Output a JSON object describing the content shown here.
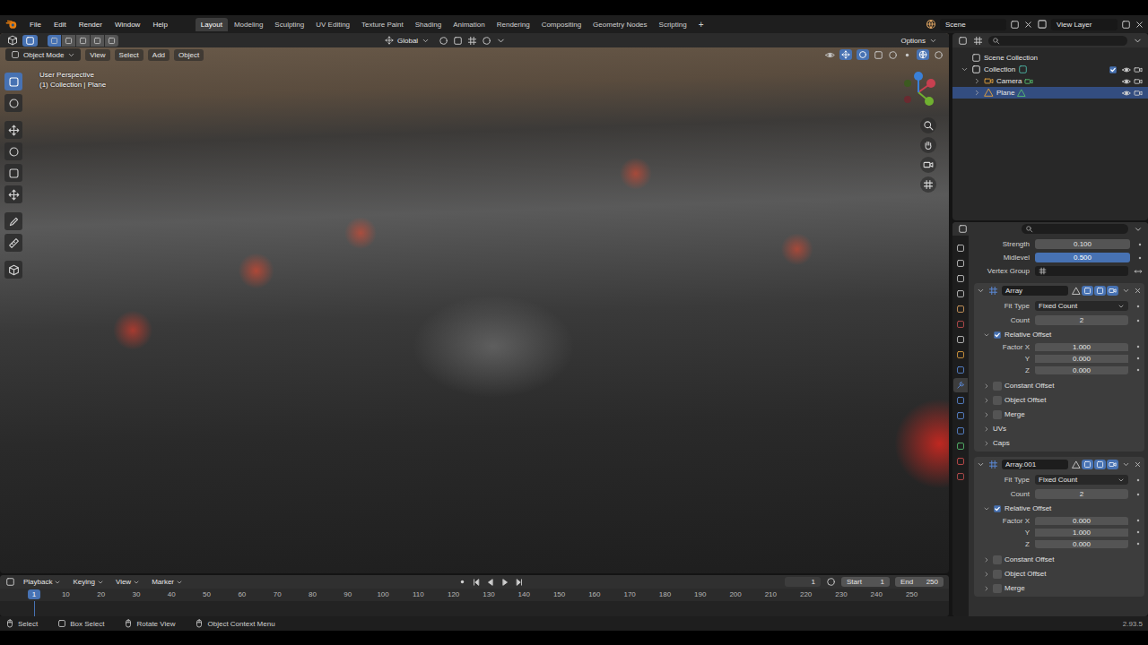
{
  "topbar": {
    "menus": [
      "File",
      "Edit",
      "Render",
      "Window",
      "Help"
    ],
    "workspaces": [
      {
        "label": "Layout",
        "selected": true
      },
      {
        "label": "Modeling",
        "selected": false
      },
      {
        "label": "Sculpting",
        "selected": false
      },
      {
        "label": "UV Editing",
        "selected": false
      },
      {
        "label": "Texture Paint",
        "selected": false
      },
      {
        "label": "Shading",
        "selected": false
      },
      {
        "label": "Animation",
        "selected": false
      },
      {
        "label": "Rendering",
        "selected": false
      },
      {
        "label": "Compositing",
        "selected": false
      },
      {
        "label": "Geometry Nodes",
        "selected": false
      },
      {
        "label": "Scripting",
        "selected": false
      }
    ],
    "add_workspace": "+",
    "scene": "Scene",
    "view_layer": "View Layer"
  },
  "viewport": {
    "transform_orientation": "Global",
    "options": "Options",
    "mode": "Object Mode",
    "menus": [
      "View",
      "Select",
      "Add",
      "Object"
    ],
    "view_name": "User Perspective",
    "context": "(1) Collection | Plane",
    "tools": [
      {
        "selected": true
      },
      {
        "selected": false
      },
      {
        "selected": false
      },
      {
        "selected": false
      },
      {
        "selected": false
      },
      {
        "selected": false
      },
      {
        "selected": false
      },
      {
        "selected": false
      },
      {
        "selected": false
      }
    ]
  },
  "outliner": {
    "items": [
      {
        "label": "Scene Collection",
        "kind": "root",
        "selected": false
      },
      {
        "label": "Collection",
        "kind": "collection",
        "expanded": true,
        "checked": true,
        "selected": false
      },
      {
        "label": "Camera",
        "kind": "object",
        "expanded": false,
        "selected": false
      },
      {
        "label": "Plane",
        "kind": "object",
        "expanded": false,
        "selected": true
      }
    ]
  },
  "properties": {
    "tabs": [
      {
        "selected": false
      },
      {
        "selected": false
      },
      {
        "selected": false
      },
      {
        "selected": false
      },
      {
        "selected": false
      },
      {
        "selected": false
      },
      {
        "selected": false
      },
      {
        "selected": false
      },
      {
        "selected": false
      },
      {
        "selected": true
      },
      {
        "selected": false
      },
      {
        "selected": false
      },
      {
        "selected": false
      },
      {
        "selected": false
      },
      {
        "selected": false
      },
      {
        "selected": false
      }
    ],
    "displace": [
      {
        "label": "Strength",
        "value": "0.100",
        "kind": "number",
        "selected": false
      },
      {
        "label": "Midlevel",
        "value": "0.500",
        "kind": "number",
        "selected": true
      },
      {
        "label": "Vertex Group",
        "kind": "search",
        "selected": false
      }
    ],
    "modifiers": [
      {
        "name": "Array",
        "expanded": true,
        "settings": [
          {
            "label": "Fit Type",
            "value": "Fixed Count",
            "kind": "dropdown"
          },
          {
            "label": "Count",
            "value": "2",
            "kind": "number"
          }
        ],
        "panels": [
          {
            "label": "Relative Offset",
            "kind": "check",
            "checked": true,
            "expanded": true,
            "fields": [
              {
                "label": "Factor X",
                "value": "1.000"
              },
              {
                "label": "Y",
                "value": "0.000"
              },
              {
                "label": "Z",
                "value": "0.000"
              }
            ]
          },
          {
            "label": "Constant Offset",
            "kind": "check",
            "checked": false,
            "expanded": false
          },
          {
            "label": "Object Offset",
            "kind": "check",
            "checked": false,
            "expanded": false
          },
          {
            "label": "Merge",
            "kind": "check",
            "checked": false,
            "expanded": false
          },
          {
            "label": "UVs",
            "kind": "plain",
            "expanded": false
          },
          {
            "label": "Caps",
            "kind": "plain",
            "expanded": false
          }
        ]
      },
      {
        "name": "Array.001",
        "expanded": true,
        "settings": [
          {
            "label": "Fit Type",
            "value": "Fixed Count",
            "kind": "dropdown"
          },
          {
            "label": "Count",
            "value": "2",
            "kind": "number"
          }
        ],
        "panels": [
          {
            "label": "Relative Offset",
            "kind": "check",
            "checked": true,
            "expanded": true,
            "fields": [
              {
                "label": "Factor X",
                "value": "0.000"
              },
              {
                "label": "Y",
                "value": "1.000"
              },
              {
                "label": "Z",
                "value": "0.000"
              }
            ]
          },
          {
            "label": "Constant Offset",
            "kind": "check",
            "checked": false,
            "expanded": false
          },
          {
            "label": "Object Offset",
            "kind": "check",
            "checked": false,
            "expanded": false
          },
          {
            "label": "Merge",
            "kind": "check",
            "checked": false,
            "expanded": false
          }
        ]
      }
    ]
  },
  "timeline": {
    "menus": [
      "Playback",
      "Keying",
      "View",
      "Marker"
    ],
    "current_frame": "1",
    "start_label": "Start",
    "start": "1",
    "end_label": "End",
    "end": "250",
    "ticks": [
      "10",
      "20",
      "30",
      "40",
      "50",
      "60",
      "70",
      "80",
      "90",
      "100",
      "110",
      "120",
      "130",
      "140",
      "150",
      "160",
      "170",
      "180",
      "190",
      "200",
      "210",
      "220",
      "230",
      "240",
      "250"
    ]
  },
  "status_bar": {
    "items": [
      {
        "label": "Select",
        "kind": "mouse-left"
      },
      {
        "label": "Box Select",
        "kind": "box"
      },
      {
        "label": "Rotate View",
        "kind": "mouse-middle"
      },
      {
        "label": "Object Context Menu",
        "kind": "mouse-right"
      }
    ],
    "version": "2.93.5"
  }
}
